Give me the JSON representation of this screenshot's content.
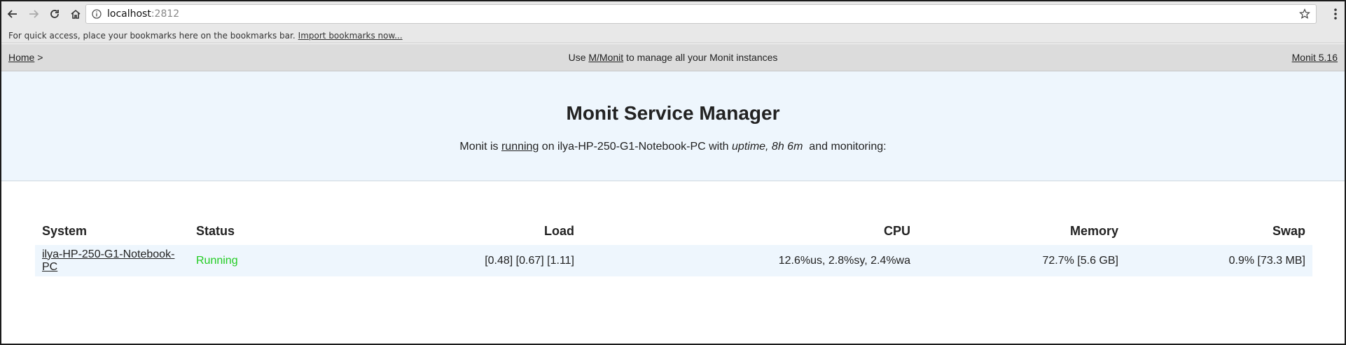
{
  "browser": {
    "url_host": "localhost",
    "url_port": ":2812",
    "icons": [
      "back-arrow-icon",
      "forward-arrow-icon",
      "reload-icon",
      "home-icon",
      "info-icon",
      "star-icon",
      "menu-icon"
    ],
    "bookmarks_text": "For quick access, place your bookmarks here on the bookmarks bar.",
    "bookmarks_link": "Import bookmarks now..."
  },
  "navbar": {
    "home_label": "Home",
    "home_sep": " >",
    "center_prefix": "Use ",
    "center_link": "M/Monit",
    "center_suffix": " to manage all your Monit instances",
    "version_link": "Monit 5.16"
  },
  "banner": {
    "title": "Monit Service Manager",
    "status_prefix": "Monit is ",
    "status_link": "running",
    "status_middle": " on ilya-HP-250-G1-Notebook-PC with ",
    "uptime": "uptime, 8h 6m",
    "status_suffix": "  and monitoring:"
  },
  "table": {
    "headers": {
      "system": "System",
      "status": "Status",
      "load": "Load",
      "cpu": "CPU",
      "memory": "Memory",
      "swap": "Swap"
    },
    "rows": [
      {
        "system": "ilya-HP-250-G1-Notebook-PC",
        "status": "Running",
        "load": "[0.48] [0.67] [1.11]",
        "cpu": "12.6%us, 2.8%sy, 2.4%wa",
        "memory": "72.7% [5.6 GB]",
        "swap": "0.9% [73.3 MB]"
      }
    ]
  },
  "colors": {
    "status_running": "#22cc22",
    "banner_bg": "#eef6fd",
    "navbar_bg": "#dcdcdc"
  }
}
